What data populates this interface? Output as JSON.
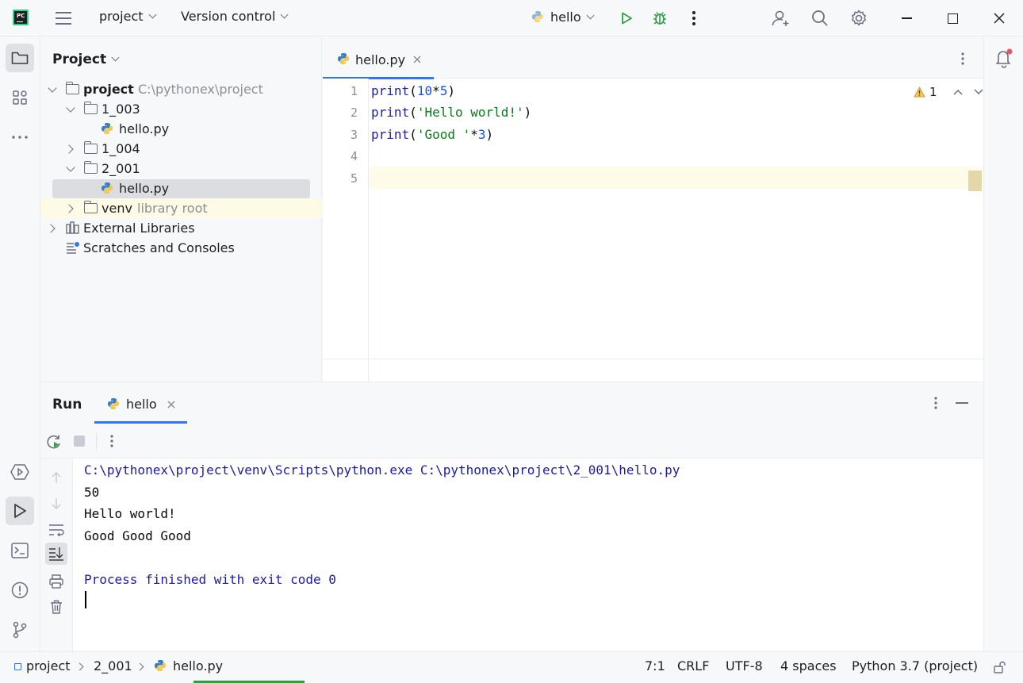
{
  "titlebar": {
    "project_label": "project",
    "vcs_label": "Version control",
    "run_config": "hello"
  },
  "project_panel": {
    "title": "Project",
    "tree": [
      {
        "label": "project",
        "hint": "C:\\pythonex\\project"
      },
      {
        "label": "1_003"
      },
      {
        "label": "hello.py"
      },
      {
        "label": "1_004"
      },
      {
        "label": "2_001"
      },
      {
        "label": "hello.py"
      },
      {
        "label": "venv",
        "hint": "library root"
      },
      {
        "label": "External Libraries"
      },
      {
        "label": "Scratches and Consoles"
      }
    ]
  },
  "editor": {
    "tab_label": "hello.py",
    "warning_count": "1",
    "line_numbers": [
      "1",
      "2",
      "3",
      "4",
      "5"
    ],
    "lines": [
      {
        "fn": "print",
        "p1": "(",
        "a": "10",
        "op": "*",
        "b": "5",
        "p2": ")"
      },
      {
        "fn": "print",
        "p1": "(",
        "s": "'Hello world!'",
        "p2": ")"
      },
      {
        "fn": "print",
        "p1": "(",
        "s": "'Good '",
        "op": "*",
        "b": "3",
        "p2": ")"
      }
    ]
  },
  "run_panel": {
    "title": "Run",
    "tab_label": "hello",
    "output": [
      "C:\\pythonex\\project\\venv\\Scripts\\python.exe C:\\pythonex\\project\\2_001\\hello.py",
      "50",
      "Hello world!",
      "Good Good Good",
      "Process finished with exit code 0"
    ]
  },
  "statusbar": {
    "crumb_project": "project",
    "crumb_folder": "2_001",
    "crumb_file": "hello.py",
    "position": "7:1",
    "line_sep": "CRLF",
    "encoding": "UTF-8",
    "indent": "4 spaces",
    "interpreter": "Python 3.7 (project)"
  },
  "colors": {
    "accent": "#3574f0",
    "run_green": "#2ea043",
    "warning": "#e6a23c"
  }
}
